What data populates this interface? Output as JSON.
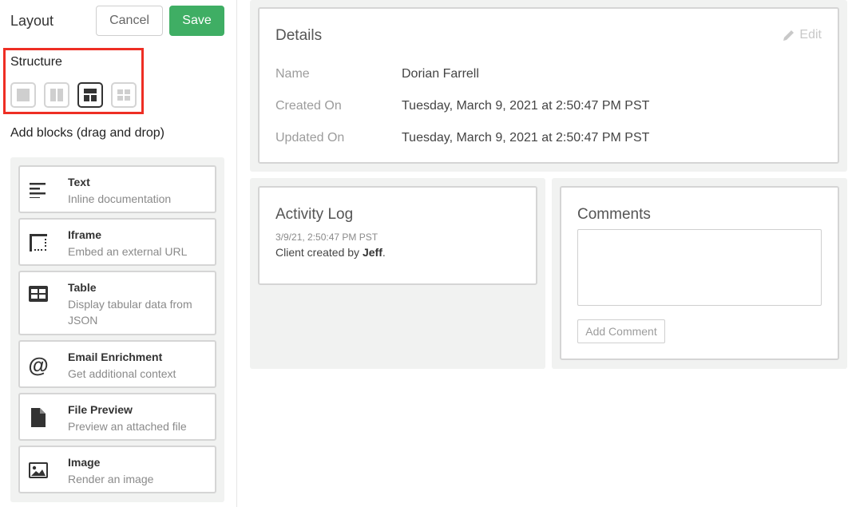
{
  "header": {
    "title": "Layout",
    "cancel_label": "Cancel",
    "save_label": "Save"
  },
  "structure": {
    "label": "Structure",
    "options": [
      "single-column",
      "two-columns",
      "top-and-two-columns",
      "grid-four"
    ],
    "selected": "top-and-two-columns"
  },
  "blocks": {
    "label": "Add blocks (drag and drop)",
    "items": [
      {
        "title": "Text",
        "description": "Inline documentation",
        "icon": "align-left-icon"
      },
      {
        "title": "Iframe",
        "description": "Embed an external URL",
        "icon": "iframe-icon"
      },
      {
        "title": "Table",
        "description": "Display tabular data from JSON",
        "icon": "table-icon"
      },
      {
        "title": "Email Enrichment",
        "description": "Get additional context",
        "icon": "at-sign-icon"
      },
      {
        "title": "File Preview",
        "description": "Preview an attached file",
        "icon": "file-icon"
      },
      {
        "title": "Image",
        "description": "Render an image",
        "icon": "image-icon"
      }
    ]
  },
  "details": {
    "title": "Details",
    "edit_label": "Edit",
    "fields": [
      {
        "label": "Name",
        "value": "Dorian Farrell"
      },
      {
        "label": "Created On",
        "value": "Tuesday, March 9, 2021 at 2:50:47 PM PST"
      },
      {
        "label": "Updated On",
        "value": "Tuesday, March 9, 2021 at 2:50:47 PM PST"
      }
    ]
  },
  "activity_log": {
    "title": "Activity Log",
    "entries": [
      {
        "timestamp": "3/9/21, 2:50:47 PM PST",
        "text_prefix": "Client created by ",
        "actor": "Jeff",
        "text_suffix": "."
      }
    ]
  },
  "comments": {
    "title": "Comments",
    "textarea_value": "",
    "button_label": "Add Comment"
  },
  "colors": {
    "save_green": "#3fae64",
    "highlight_red": "#ee2e24",
    "panel_gray": "#f1f2f1"
  }
}
